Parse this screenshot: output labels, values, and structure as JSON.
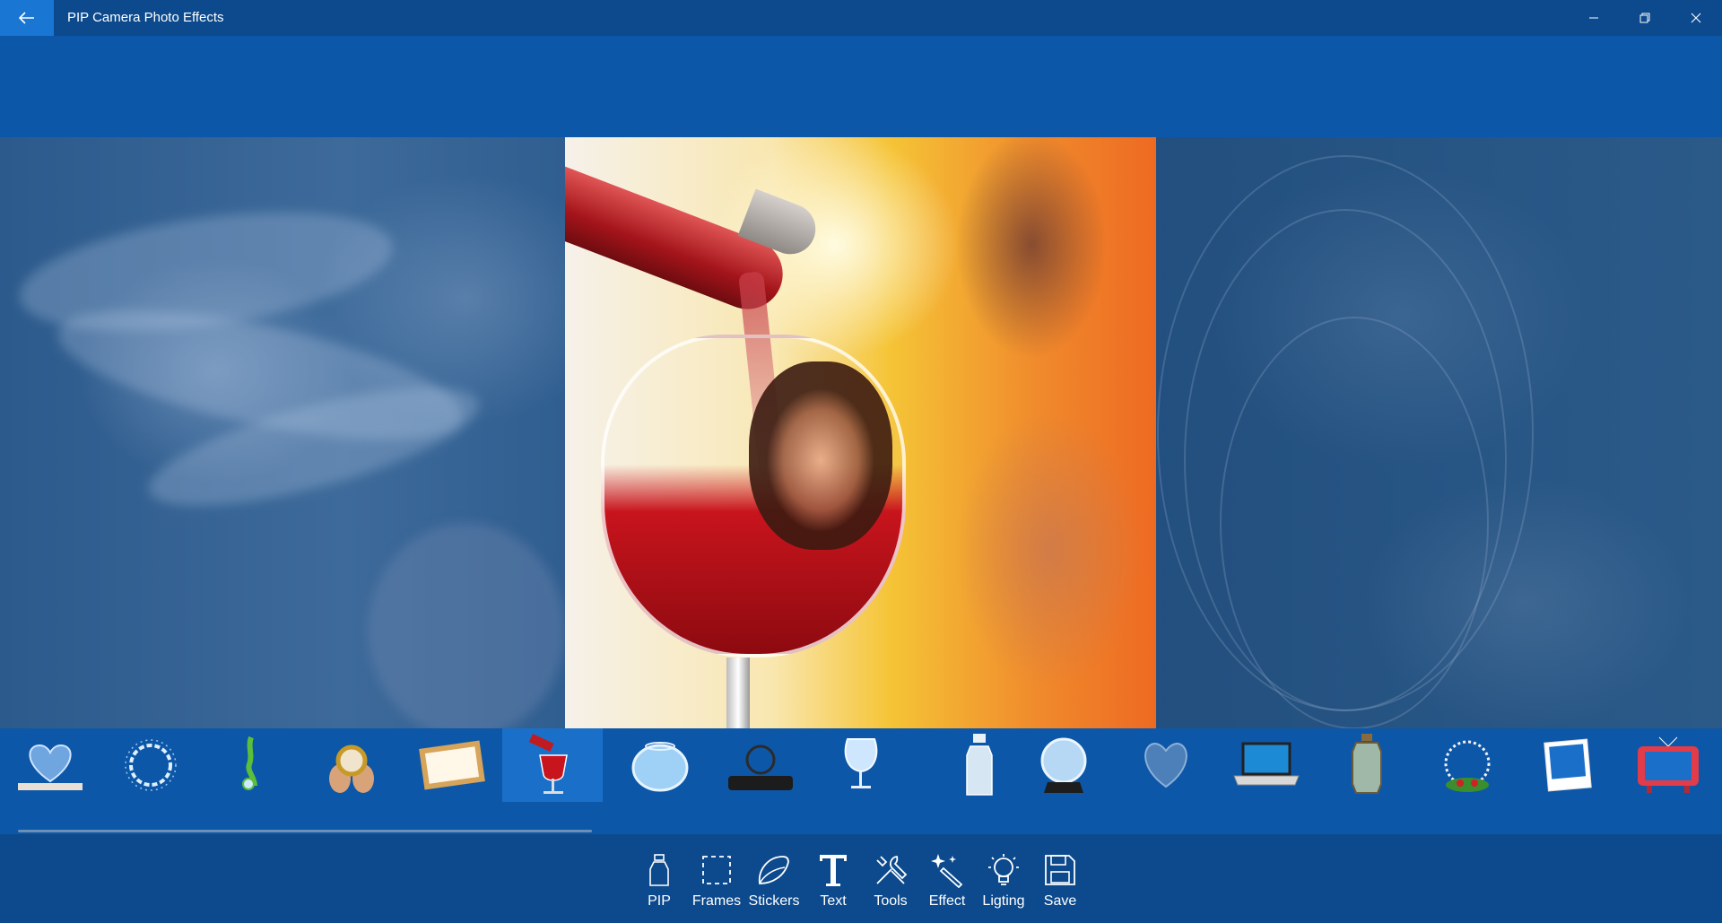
{
  "window": {
    "title": "PIP Camera Photo Effects",
    "controls": [
      "minimize-icon",
      "restore-icon",
      "close-icon"
    ]
  },
  "colors": {
    "titlebar": "#0c4a8d",
    "band": "#0d57a8",
    "accent": "#1976d2",
    "selected_thumb": "#1a6fc9"
  },
  "frames_strip": {
    "selected_index": 5,
    "items": [
      {
        "icon": "glass-heart-frame-icon"
      },
      {
        "icon": "water-splash-frame-icon"
      },
      {
        "icon": "green-drop-frame-icon"
      },
      {
        "icon": "hands-holding-frame-icon"
      },
      {
        "icon": "wooden-photo-frame-icon"
      },
      {
        "icon": "wine-glass-pour-frame-icon"
      },
      {
        "icon": "fish-bowl-frame-icon"
      },
      {
        "icon": "magnifier-rock-frame-icon"
      },
      {
        "icon": "brandy-glass-frame-icon"
      },
      {
        "icon": "milk-bottle-frame-icon"
      },
      {
        "icon": "snow-globe-frame-icon"
      },
      {
        "icon": "blue-heart-frame-icon"
      },
      {
        "icon": "laptop-frame-icon"
      },
      {
        "icon": "lantern-frame-icon"
      },
      {
        "icon": "christmas-wreath-frame-icon"
      },
      {
        "icon": "polaroid-frame-icon"
      },
      {
        "icon": "red-tv-frame-icon"
      }
    ]
  },
  "toolbar": {
    "items": [
      {
        "label": "PIP",
        "icon": "bottle-icon"
      },
      {
        "label": "Frames",
        "icon": "dashed-frame-icon"
      },
      {
        "label": "Stickers",
        "icon": "sticker-icon"
      },
      {
        "label": "Text",
        "icon": "text-t-icon"
      },
      {
        "label": "Tools",
        "icon": "tools-icon"
      },
      {
        "label": "Effect",
        "icon": "magic-wand-icon"
      },
      {
        "label": "Ligting",
        "icon": "lightbulb-icon"
      },
      {
        "label": "Save",
        "icon": "floppy-disk-icon"
      }
    ]
  }
}
